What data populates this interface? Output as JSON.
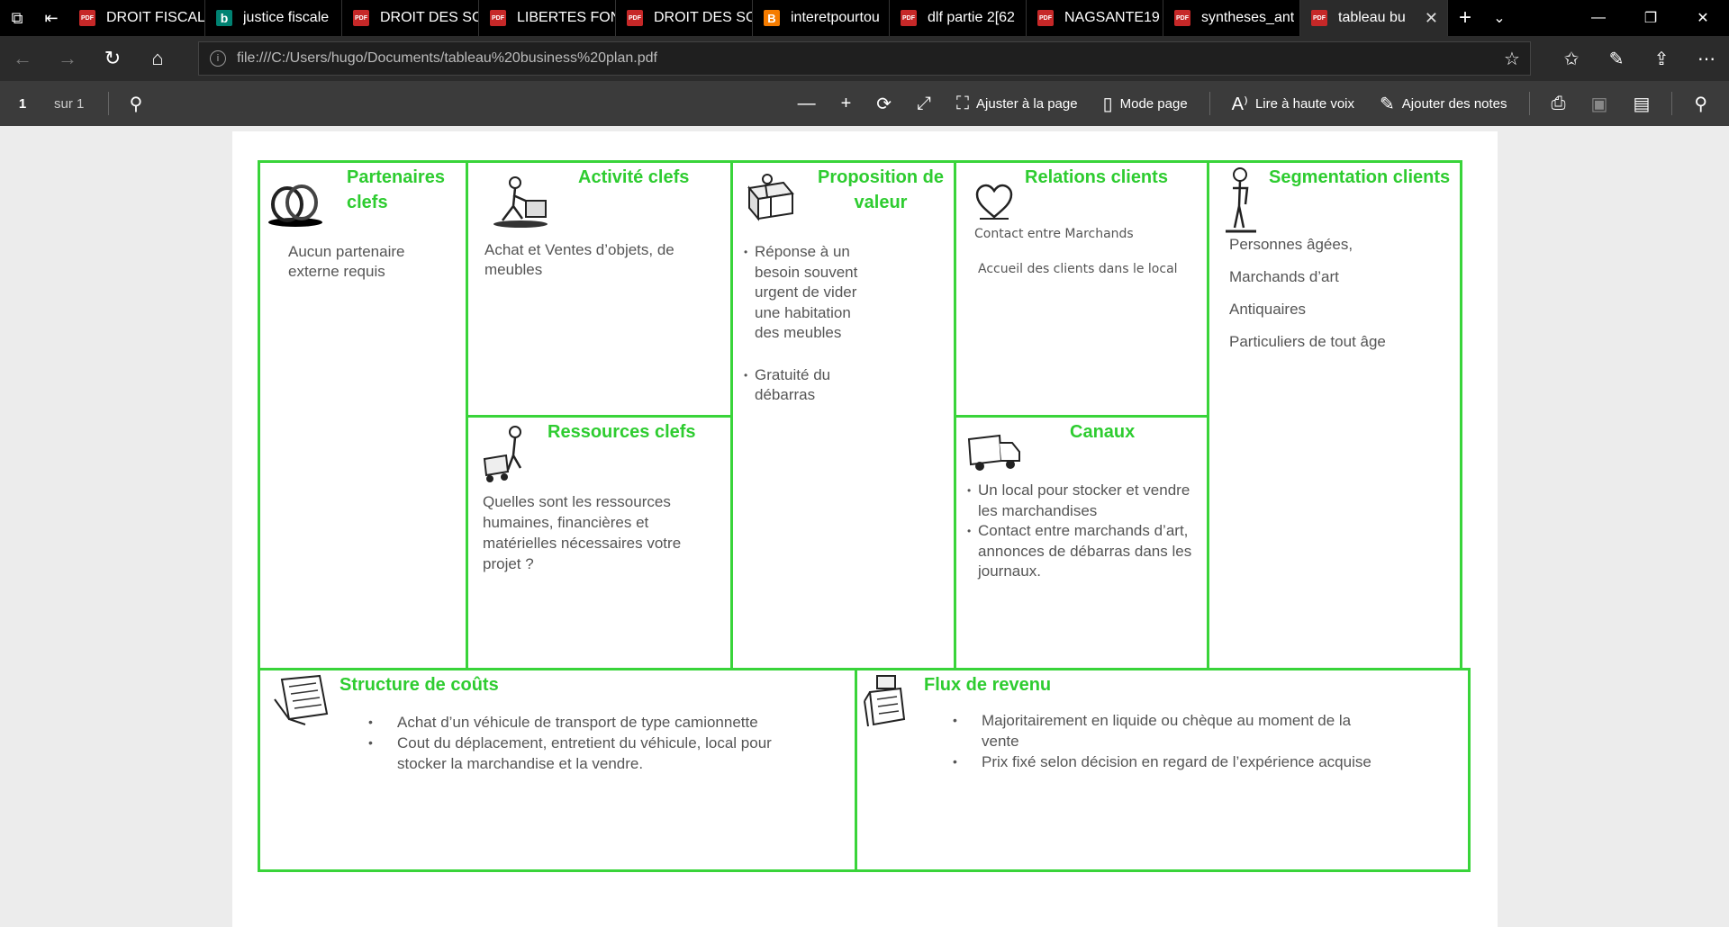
{
  "tabs": [
    {
      "label": "DROIT FISCAL",
      "icon": "pdf-icon"
    },
    {
      "label": "justice fiscale",
      "icon": "bing-icon"
    },
    {
      "label": "DROIT DES SC",
      "icon": "pdf-icon"
    },
    {
      "label": "LIBERTES FON",
      "icon": "pdf-icon"
    },
    {
      "label": "DROIT DES SC",
      "icon": "pdf-icon"
    },
    {
      "label": "interetpourtou",
      "icon": "blogger-icon"
    },
    {
      "label": "dlf partie 2[62",
      "icon": "pdf-icon"
    },
    {
      "label": "NAGSANTE19",
      "icon": "pdf-icon"
    },
    {
      "label": "syntheses_ant",
      "icon": "pdf-icon"
    },
    {
      "label": "tableau bu",
      "icon": "pdf-icon",
      "active": true
    }
  ],
  "address": {
    "url": "file:///C:/Users/hugo/Documents/tableau%20business%20plan.pdf"
  },
  "pdf_toolbar": {
    "page_number": "1",
    "page_of": "sur 1",
    "fit_page": "Ajuster à la page",
    "page_mode": "Mode page",
    "read_aloud": "Lire à haute voix",
    "add_notes": "Ajouter des notes"
  },
  "canvas": {
    "partenaires": {
      "title_l1": "Partenaires",
      "title_l2": "clefs",
      "text": "Aucun partenaire externe requis"
    },
    "activites": {
      "title": "Activité clefs",
      "text": "Achat et Ventes d’objets, de meubles"
    },
    "ressources": {
      "title": "Ressources clefs",
      "text": "Quelles sont les ressources humaines, financières et matérielles nécessaires votre projet ?"
    },
    "proposition": {
      "title_l1": "Proposition de",
      "title_l2": "valeur",
      "items": [
        "Réponse à un besoin souvent urgent de vider une habitation des meubles",
        "Gratuité du débarras"
      ]
    },
    "relations": {
      "title": "Relations clients",
      "line1": "Contact entre Marchands",
      "line2": "Accueil des clients dans le local"
    },
    "canaux": {
      "title": "Canaux",
      "items": [
        "Un local pour stocker et vendre les marchandises",
        "Contact entre marchands d’art, annonces de débarras dans les journaux."
      ]
    },
    "segmentation": {
      "title": "Segmentation clients",
      "items": [
        "Personnes âgées,",
        "Marchands d’art",
        "Antiquaires",
        "Particuliers de tout âge"
      ]
    },
    "couts": {
      "title": "Structure de coûts",
      "items": [
        "Achat d’un véhicule de transport de type camionnette",
        "Cout du déplacement, entretient du véhicule, local pour stocker la marchandise et la vendre."
      ]
    },
    "revenus": {
      "title": "Flux de revenu",
      "items": [
        "Majoritairement en liquide ou chèque au moment de la vente",
        "Prix fixé selon décision en regard de l’expérience acquise"
      ]
    }
  },
  "colors": {
    "accent_green": "#39d43a",
    "title_green": "#2ecc30",
    "body_text": "#555555"
  }
}
